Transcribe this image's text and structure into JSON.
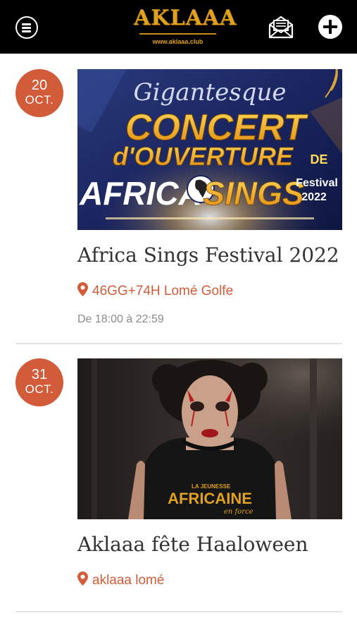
{
  "header": {
    "logo_text": "AKLAAA",
    "logo_url": "www.aklaaa.club",
    "menu_icon": "hamburger-menu-icon",
    "mail_icon": "envelope-icon",
    "add_icon": "plus-icon"
  },
  "events": [
    {
      "day": "20",
      "month": "OCT.",
      "title": "Africa Sings Festival 2022",
      "location": "46GG+74H Lomé Golfe",
      "time": "De 18:00 à 22:59",
      "poster": {
        "line1": "Gigantesque",
        "line2": "CONCERT",
        "line3": "d'OUVERTURE",
        "line3b": "DE",
        "line4a": "AFRICA",
        "line4b": "SINGS",
        "tag1": "Festival",
        "tag2": "2022"
      }
    },
    {
      "day": "31",
      "month": "OCT.",
      "title": "Aklaaa fête Haaloween",
      "location": "aklaaa lomé",
      "poster": {
        "shirt_line1": "LA JEUNESSE",
        "shirt_line2": "AFRICAINE",
        "shirt_line3": "en force"
      }
    }
  ],
  "colors": {
    "accent": "#d25c3a",
    "header_bg": "#000000",
    "logo_gold": "#e0a020"
  }
}
